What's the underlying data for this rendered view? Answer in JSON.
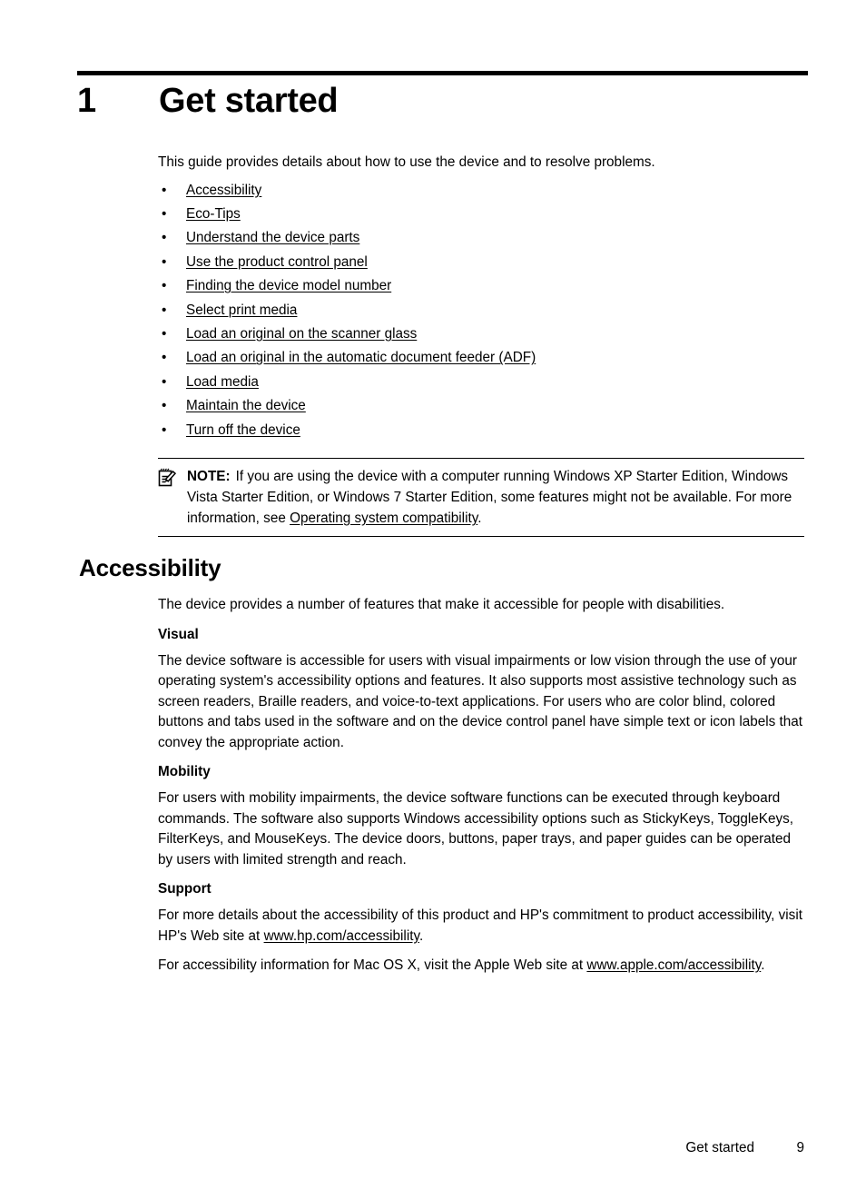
{
  "chapter": {
    "number": "1",
    "title": "Get started"
  },
  "intro": "This guide provides details about how to use the device and to resolve problems.",
  "link_list": {
    "bullet": "•",
    "items": [
      "Accessibility",
      "Eco-Tips",
      "Understand the device parts",
      "Use the product control panel",
      "Finding the device model number",
      "Select print media",
      "Load an original on the scanner glass",
      "Load an original in the automatic document feeder (ADF)",
      "Load media",
      "Maintain the device",
      "Turn off the device"
    ]
  },
  "note": {
    "icon_name": "note-pencil-icon",
    "label": "NOTE:",
    "text_before_link": "If you are using the device with a computer running Windows XP Starter Edition, Windows Vista Starter Edition, or Windows 7 Starter Edition, some features might not be available. For more information, see ",
    "link": "Operating system compatibility",
    "text_after_link": "."
  },
  "section": {
    "heading": "Accessibility",
    "intro": "The device provides a number of features that make it accessible for people with disabilities.",
    "subsections": [
      {
        "heading": "Visual",
        "paragraphs": [
          "The device software is accessible for users with visual impairments or low vision through the use of your operating system's accessibility options and features. It also supports most assistive technology such as screen readers, Braille readers, and voice-to-text applications. For users who are color blind, colored buttons and tabs used in the software and on the device control panel have simple text or icon labels that convey the appropriate action."
        ]
      },
      {
        "heading": "Mobility",
        "paragraphs": [
          "For users with mobility impairments, the device software functions can be executed through keyboard commands. The software also supports Windows accessibility options such as StickyKeys, ToggleKeys, FilterKeys, and MouseKeys. The device doors, buttons, paper trays, and paper guides can be operated by users with limited strength and reach."
        ]
      }
    ],
    "support": {
      "heading": "Support",
      "para1_before_link": "For more details about the accessibility of this product and HP's commitment to product accessibility, visit HP's Web site at ",
      "para1_link": "www.hp.com/accessibility",
      "para1_after_link": ".",
      "para2_before_link": "For accessibility information for Mac OS X, visit the Apple Web site at ",
      "para2_link": "www.apple.com/accessibility",
      "para2_after_link": "."
    }
  },
  "footer": {
    "chapter_label": "Get started",
    "page_number": "9"
  },
  "colors": {
    "text": "#000000",
    "background": "#ffffff"
  }
}
